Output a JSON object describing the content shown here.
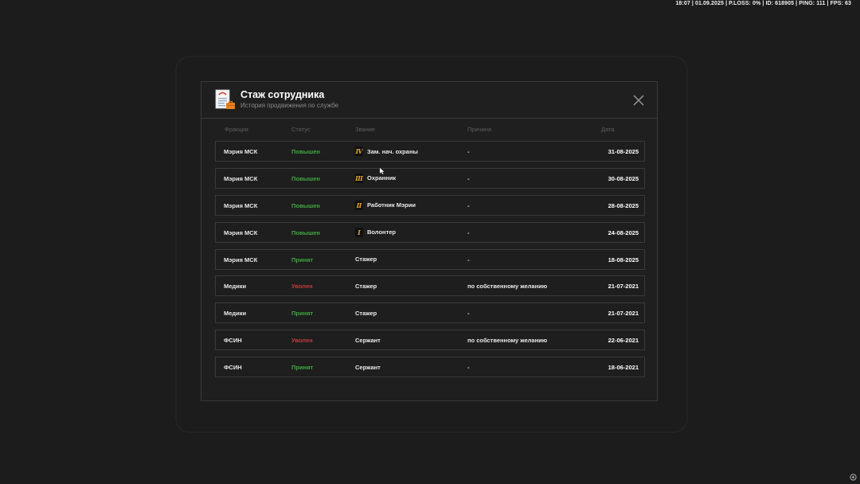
{
  "hud": {
    "text": "18:07 | 01.09.2025 | P.LOSS: 0% | ID: 618905 | PING: 111 | FPS: 63"
  },
  "window": {
    "title": "Стаж сотрудника",
    "subtitle": "История продвижения по службе",
    "icon": "document-icon",
    "close_icon": "close-icon"
  },
  "columns": {
    "faction": "Фракция",
    "status": "Статус",
    "rank": "Звание",
    "reason": "Причина",
    "date": "Дата"
  },
  "colors": {
    "promoted": "#3fa940",
    "fired": "#c23b3b",
    "accent": "#e3a32a"
  },
  "rows": [
    {
      "faction": "Мэрия МСК",
      "status": "Повышен",
      "status_type": "green",
      "rank_icon": "Ⅳ",
      "rank": "Зам. нач. охраны",
      "reason": "-",
      "date": "31-08-2025"
    },
    {
      "faction": "Мэрия МСК",
      "status": "Повышен",
      "status_type": "green",
      "rank_icon": "Ⅲ",
      "rank": "Охранник",
      "reason": "-",
      "date": "30-08-2025"
    },
    {
      "faction": "Мэрия МСК",
      "status": "Повышен",
      "status_type": "green",
      "rank_icon": "Ⅱ",
      "rank": "Работник Мэрии",
      "reason": "-",
      "date": "28-08-2025"
    },
    {
      "faction": "Мэрия МСК",
      "status": "Повышен",
      "status_type": "green",
      "rank_icon": "Ⅰ",
      "rank": "Волонтер",
      "reason": "-",
      "date": "24-08-2025"
    },
    {
      "faction": "Мэрия МСК",
      "status": "Принят",
      "status_type": "green",
      "rank_icon": "",
      "rank": "Стажер",
      "reason": "-",
      "date": "18-08-2025"
    },
    {
      "faction": "Медики",
      "status": "Уволен",
      "status_type": "red",
      "rank_icon": "",
      "rank": "Стажер",
      "reason": "по собственному желанию",
      "date": "21-07-2021"
    },
    {
      "faction": "Медики",
      "status": "Принят",
      "status_type": "green",
      "rank_icon": "",
      "rank": "Стажер",
      "reason": "-",
      "date": "21-07-2021"
    },
    {
      "faction": "ФСИН",
      "status": "Уволен",
      "status_type": "red",
      "rank_icon": "",
      "rank": "Сержант",
      "reason": "по собственному желанию",
      "date": "22-06-2021"
    },
    {
      "faction": "ФСИН",
      "status": "Принят",
      "status_type": "green",
      "rank_icon": "",
      "rank": "Сержант",
      "reason": "-",
      "date": "18-06-2021"
    }
  ]
}
